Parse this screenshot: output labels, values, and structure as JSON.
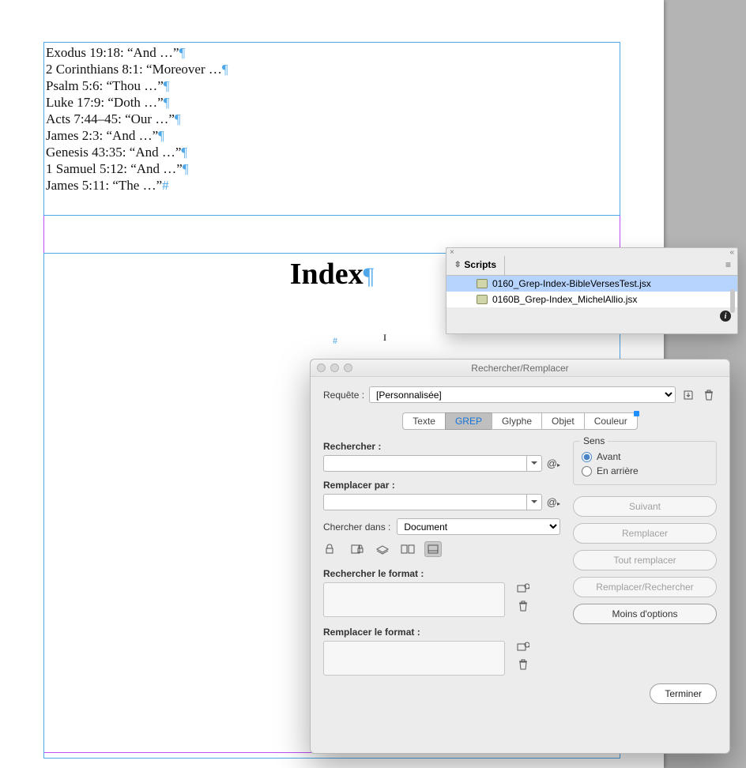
{
  "document": {
    "body_lines": [
      "Exodus 19:18: “And …”",
      "2 Corinthians 8:1: “Moreover …",
      "Psalm 5:6: “Thou …”",
      "Luke 17:9: “Doth …”",
      "Acts 7:44–45: “Our …”",
      "James 2:3: “And …”",
      "Genesis 43:35: “And …”",
      "1 Samuel 5:12: “And …”",
      "James 5:11: “The …”"
    ],
    "index_heading": "Index"
  },
  "scripts_panel": {
    "tab_label": "Scripts",
    "items": [
      {
        "name": "0160_Grep-Index-BibleVersesTest.jsx",
        "selected": true
      },
      {
        "name": "0160B_Grep-Index_MichelAllio.jsx",
        "selected": false
      }
    ]
  },
  "dialog": {
    "title": "Rechercher/Remplacer",
    "query_label": "Requête :",
    "query_value": "[Personnalisée]",
    "tabs": {
      "text": "Texte",
      "grep": "GREP",
      "glyph": "Glyphe",
      "object": "Objet",
      "color": "Couleur"
    },
    "search_label": "Rechercher :",
    "search_value": "",
    "replace_label": "Remplacer par :",
    "replace_value": "",
    "scope_label": "Chercher dans :",
    "scope_value": "Document",
    "search_format_label": "Rechercher le format :",
    "replace_format_label": "Remplacer le format :",
    "direction": {
      "legend": "Sens",
      "forward": "Avant",
      "backward": "En arrière"
    },
    "buttons": {
      "next": "Suivant",
      "replace": "Remplacer",
      "replace_all": "Tout remplacer",
      "replace_find": "Remplacer/Rechercher",
      "fewer": "Moins d'options",
      "done": "Terminer"
    }
  }
}
